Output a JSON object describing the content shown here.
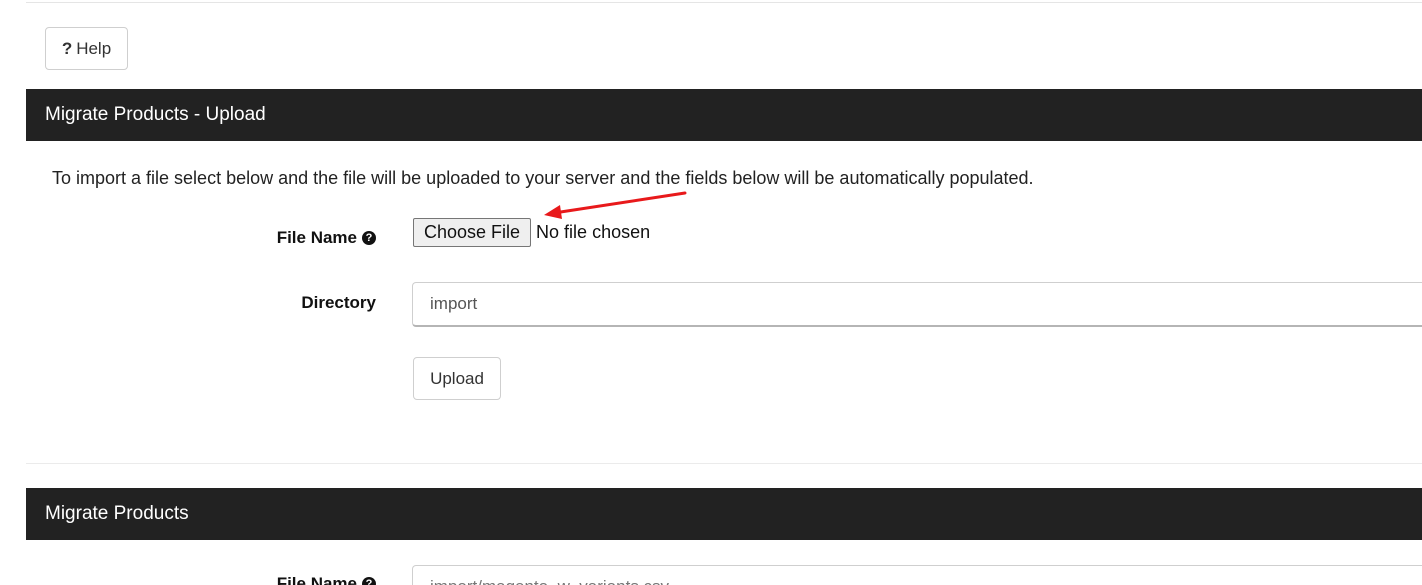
{
  "toolbar": {
    "help_label": "Help",
    "help_icon": "question-mark"
  },
  "upload_panel": {
    "title": "Migrate Products - Upload",
    "intro": "To import a file select below and the file will be uploaded to your server and the fields below will be automatically populated.",
    "file_name_label": "File Name",
    "choose_file_label": "Choose File",
    "no_file_text": "No file chosen",
    "directory_label": "Directory",
    "directory_value": "import",
    "upload_label": "Upload"
  },
  "migrate_panel": {
    "title": "Migrate Products",
    "file_name_label": "File Name",
    "file_name_value": "import/magento_w_variants.csv"
  },
  "colors": {
    "header_bg": "#222222",
    "annotation_arrow": "#e8191b"
  }
}
